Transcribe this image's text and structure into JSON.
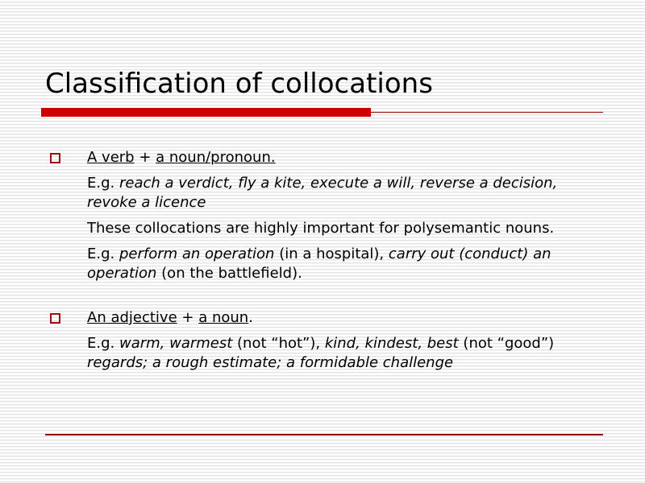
{
  "slide": {
    "title": "Classification of collocations",
    "background_color": "#ffffff",
    "accent_color_bright": "#cc0000",
    "accent_color_dark": "#8c1111",
    "bullet_marker_color": "#9e1010",
    "text_color": "#000000"
  },
  "bullets": [
    {
      "marker": "hollow-square-bullet",
      "heading": {
        "part_underlined_1": "A verb",
        "part_plain": " + ",
        "part_underlined_2": "a noun/pronoun."
      },
      "lines": [
        {
          "id": "example-1",
          "segments": [
            {
              "text": "E.g. ",
              "style": "regular"
            },
            {
              "text": "reach a verdict, fly a kite, execute a will, reverse a decision, revoke a licence",
              "style": "italic"
            }
          ]
        },
        {
          "id": "note-1",
          "segments": [
            {
              "text": "These collocations are highly important for polysemantic nouns.",
              "style": "regular"
            }
          ]
        },
        {
          "id": "example-2",
          "segments": [
            {
              "text": "E.g. ",
              "style": "regular"
            },
            {
              "text": "perform an operation",
              "style": "italic"
            },
            {
              "text": " (in a hospital), ",
              "style": "regular"
            },
            {
              "text": "carry out (conduct) an operation",
              "style": "italic"
            },
            {
              "text": " (on the battlefield).",
              "style": "regular"
            }
          ]
        }
      ]
    },
    {
      "marker": "hollow-square-bullet",
      "heading": {
        "part_underlined_1": "An adjective",
        "part_plain": " + ",
        "part_underlined_2": "a noun",
        "part_trailing": "."
      },
      "lines": [
        {
          "id": "example-3",
          "segments": [
            {
              "text": "E.g. ",
              "style": "regular"
            },
            {
              "text": "warm, warmest",
              "style": "italic"
            },
            {
              "text": " (not “hot”), ",
              "style": "regular"
            },
            {
              "text": "kind, kindest, best",
              "style": "italic"
            },
            {
              "text": " (not “good”) ",
              "style": "regular"
            },
            {
              "text": "regards; a rough estimate; a formidable challenge",
              "style": "italic"
            }
          ]
        }
      ]
    }
  ],
  "text": {
    "b1_h_u1": "A verb",
    "b1_h_plus": " + ",
    "b1_h_u2": "a noun/pronoun.",
    "b1_l1_eg": "E.g. ",
    "b1_l1_it": "reach a verdict, fly a kite, execute a will, reverse a decision, revoke a licence",
    "b1_l2": "These collocations are highly important for polysemantic nouns.",
    "b1_l3_eg": "E.g. ",
    "b1_l3_it1": "perform an operation",
    "b1_l3_p1": " (in a hospital), ",
    "b1_l3_it2": "carry out (conduct) an operation",
    "b1_l3_p2": " (on the battlefield).",
    "b2_h_u1": "An adjective",
    "b2_h_plus": " + ",
    "b2_h_u2": "a noun",
    "b2_h_dot": ".",
    "b2_l1_eg": "E.g. ",
    "b2_l1_it1": "warm, warmest",
    "b2_l1_p1": " (not “hot”), ",
    "b2_l1_it2": "kind, kindest, best",
    "b2_l1_p2": " (not “good”) ",
    "b2_l1_it3": "regards; a rough estimate; a formidable challenge"
  }
}
